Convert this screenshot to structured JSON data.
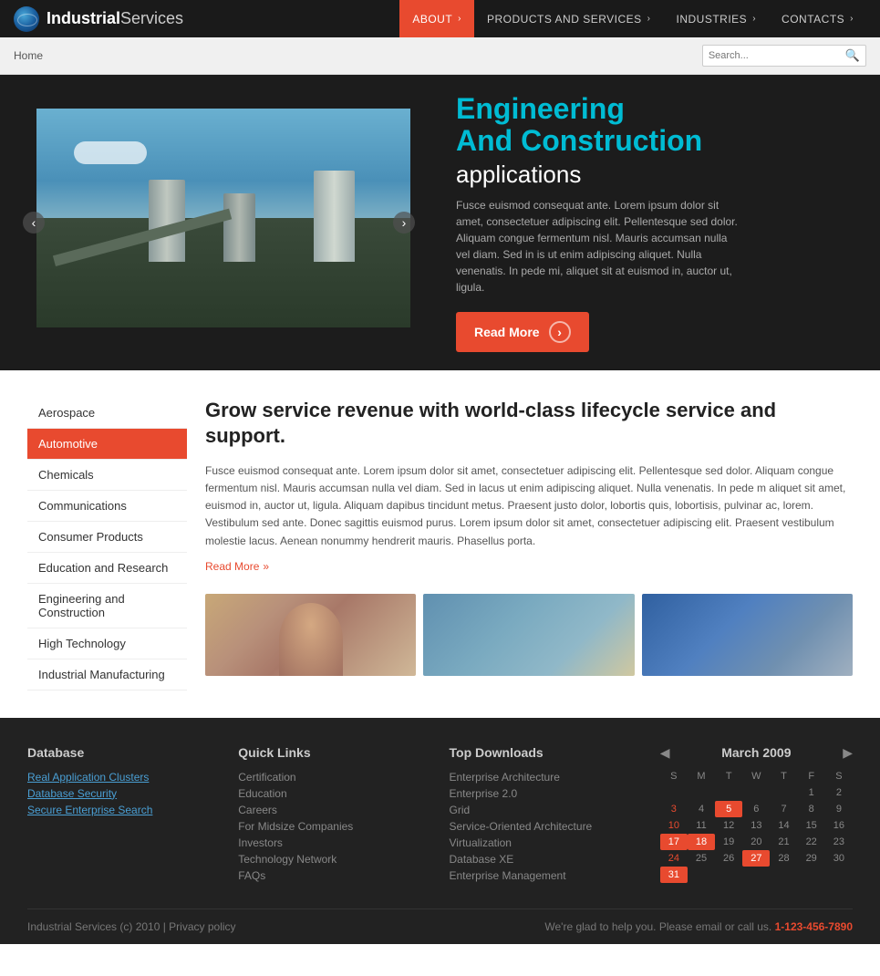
{
  "header": {
    "logo": {
      "brand_industrial": "Industrial",
      "brand_services": "Services"
    },
    "nav": [
      {
        "label": "ABOUT",
        "active": true
      },
      {
        "label": "PRODUCTS AND SERVICES",
        "active": false
      },
      {
        "label": "INDUSTRIES",
        "active": false
      },
      {
        "label": "CONTACTS",
        "active": false
      }
    ]
  },
  "breadcrumb": {
    "home": "Home",
    "search_placeholder": "Search..."
  },
  "hero": {
    "title_highlight": "Engineering",
    "title_highlight2": "And Construction",
    "title_normal": "applications",
    "description": "Fusce euismod consequat ante. Lorem ipsum dolor sit amet, consectetuer adipiscing elit. Pellentesque sed dolor. Aliquam congue fermentum nisl. Mauris accumsan nulla vel diam. Sed in is ut enim adipiscing aliquet. Nulla venenatis. In pede mi, aliquet sit at euismod in, auctor ut, ligula.",
    "read_more": "Read More"
  },
  "sidebar": {
    "items": [
      {
        "label": "Aerospace",
        "active": false
      },
      {
        "label": "Automotive",
        "active": true
      },
      {
        "label": "Chemicals",
        "active": false
      },
      {
        "label": "Communications",
        "active": false
      },
      {
        "label": "Consumer Products",
        "active": false
      },
      {
        "label": "Education and Research",
        "active": false
      },
      {
        "label": "Engineering and Construction",
        "active": false
      },
      {
        "label": "High Technology",
        "active": false
      },
      {
        "label": "Industrial Manufacturing",
        "active": false
      }
    ]
  },
  "main": {
    "heading": "Grow service revenue with world-class lifecycle service and support.",
    "description": "Fusce euismod consequat ante. Lorem ipsum dolor sit amet, consectetuer adipiscing elit. Pellentesque sed dolor. Aliquam congue fermentum nisl. Mauris accumsan nulla vel diam. Sed in lacus ut enim adipiscing aliquet. Nulla venenatis. In pede m aliquet sit amet, euismod in, auctor ut, ligula. Aliquam dapibus tincidunt metus. Praesent justo dolor, lobortis quis, lobortisis, pulvinar ac, lorem. Vestibulum sed ante. Donec sagittis euismod purus. Lorem ipsum dolor sit amet, consectetuer adipiscing elit. Praesent vestibulum molestie lacus. Aenean nonummy hendrerit mauris. Phasellus porta.",
    "read_more": "Read More"
  },
  "footer": {
    "database": {
      "title": "Database",
      "links": [
        "Real Application Clusters",
        "Database Security",
        "Secure Enterprise Search"
      ]
    },
    "quick_links": {
      "title": "Quick Links",
      "links": [
        "Certification",
        "Education",
        "Careers",
        "For Midsize Companies",
        "Investors",
        "Technology Network",
        "FAQs"
      ]
    },
    "top_downloads": {
      "title": "Top Downloads",
      "links": [
        "Enterprise Architecture",
        "Enterprise 2.0",
        "Grid",
        "Service-Oriented Architecture",
        "Virtualization",
        "Database XE",
        "Enterprise Management"
      ]
    },
    "calendar": {
      "title": "March 2009",
      "days_header": [
        "S",
        "M",
        "T",
        "W",
        "T",
        "F",
        "S"
      ],
      "weeks": [
        [
          "",
          "",
          "",
          "",
          "",
          "",
          "1",
          "2"
        ],
        [
          "3",
          "4",
          "5",
          "6",
          "7",
          "8",
          "9"
        ],
        [
          "10",
          "11",
          "12",
          "13",
          "14",
          "15",
          "16"
        ],
        [
          "17",
          "18",
          "19",
          "20",
          "21",
          "22",
          "23"
        ],
        [
          "24",
          "25",
          "26",
          "27",
          "28",
          "29",
          "30"
        ],
        [
          "31",
          "",
          "",
          "",
          "",
          "",
          ""
        ]
      ],
      "today": "5",
      "highlighted": [
        "17",
        "18",
        "27",
        "31"
      ]
    },
    "bottom": {
      "copyright": "Industrial Services (c) 2010  |  Privacy policy",
      "help_text": "We're glad to help you. Please email or call us.",
      "phone": "1-123-456-7890"
    }
  }
}
